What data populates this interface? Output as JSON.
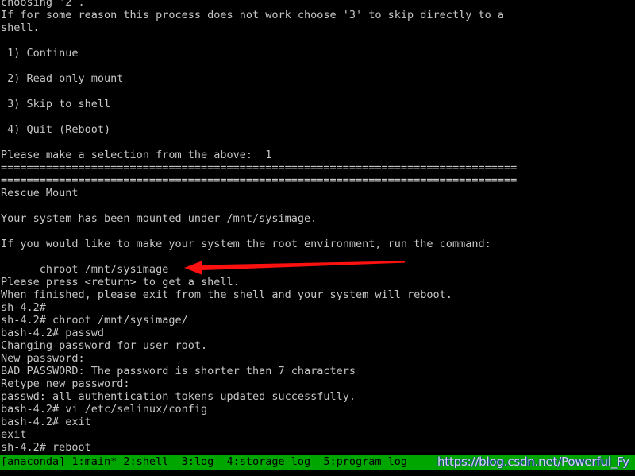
{
  "terminal": {
    "background_color": "#000000",
    "text_color": "#c6c6c6",
    "lines": [
      "choosing '2'.",
      "If for some reason this process does not work choose '3' to skip directly to a",
      "shell.",
      "",
      " 1) Continue",
      "",
      " 2) Read-only mount",
      "",
      " 3) Skip to shell",
      "",
      " 4) Quit (Reboot)",
      "",
      "Please make a selection from the above:  1",
      "================================================================================",
      "================================================================================",
      "Rescue Mount",
      "",
      "Your system has been mounted under /mnt/sysimage.",
      "",
      "If you would like to make your system the root environment, run the command:",
      "",
      "      chroot /mnt/sysimage",
      "Please press <return> to get a shell.",
      "When finished, please exit from the shell and your system will reboot.",
      "sh-4.2# ",
      "sh-4.2# chroot /mnt/sysimage/",
      "bash-4.2# passwd",
      "Changing password for user root.",
      "New password:",
      "BAD PASSWORD: The password is shorter than 7 characters",
      "Retype new password:",
      "passwd: all authentication tokens updated successfully.",
      "bash-4.2# vi /etc/selinux/config",
      "bash-4.2# exit",
      "exit",
      "sh-4.2# reboot"
    ]
  },
  "annotation": {
    "arrow": {
      "name": "red-left-arrow",
      "color": "#ff0000",
      "points_to": "chroot /mnt/sysimage"
    }
  },
  "status_bar": {
    "background_color": "#00a600",
    "text_color": "#000000",
    "text": "[anaconda] 1:main* 2:shell  3:log  4:storage-log  5:program-log",
    "items": [
      {
        "label": "[anaconda]"
      },
      {
        "label": "1:main*"
      },
      {
        "label": "2:shell"
      },
      {
        "label": "3:log"
      },
      {
        "label": "4:storage-log"
      },
      {
        "label": "5:program-log"
      }
    ]
  },
  "watermark": {
    "text": "https://blog.csdn.net/Powerful_Fy"
  }
}
